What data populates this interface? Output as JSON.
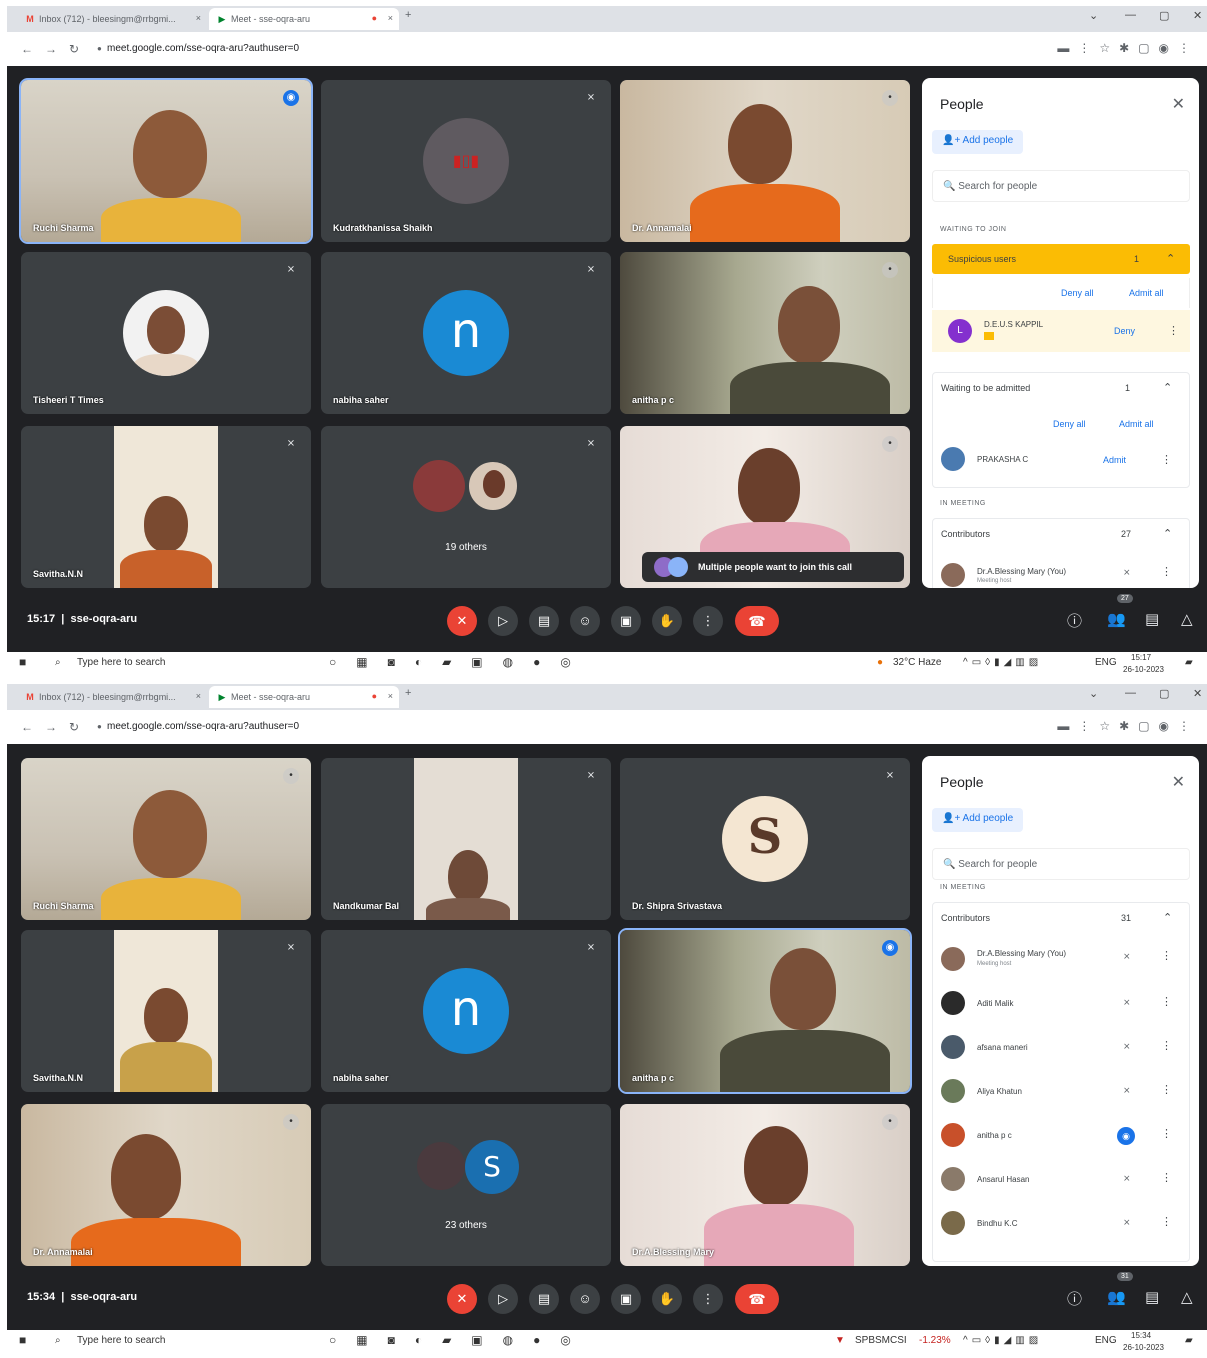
{
  "browser": {
    "tab1": "Inbox (712) - bleesingm@rrbgmi...",
    "tab2": "Meet - sse-oqra-aru",
    "url": "meet.google.com/sse-oqra-aru?authuser=0",
    "new_tab": "+"
  },
  "meeting_code": "sse-oqra-aru",
  "panel1": {
    "time": "15:17",
    "tiles": {
      "t1": "Ruchi Sharma",
      "t2": "Kudratkhanissa Shaikh",
      "t3": "Dr. Annamalai",
      "t4": "Tisheeri T Times",
      "t5": "nabiha saher",
      "t6": "anitha p c",
      "t7": "Savitha.N.N",
      "t8": "19 others",
      "t9_notice": "Multiple people want to join this call"
    },
    "avatar_letter": "n",
    "people": {
      "title": "People",
      "add": "Add people",
      "search": "Search for people",
      "waiting_section": "WAITING TO JOIN",
      "suspicious": "Suspicious users",
      "suspicious_count": "1",
      "deny_all": "Deny all",
      "admit_all": "Admit all",
      "sus_user": "D.E.U.S KAPPIL",
      "deny": "Deny",
      "waiting_admit": "Waiting to be admitted",
      "waiting_count": "1",
      "deny_all2": "Deny all",
      "admit_all2": "Admit all",
      "wait_user": "PRAKASHA C",
      "admit": "Admit",
      "in_meeting": "IN MEETING",
      "contributors": "Contributors",
      "contrib_count": "27",
      "first_user": "Dr.A.Blessing Mary (You)",
      "first_sub": "Meeting host"
    },
    "people_badge": "27",
    "taskbar": {
      "search": "Type here to search",
      "weather": "32°C Haze",
      "lang": "ENG",
      "time": "15:17",
      "date": "26-10-2023"
    }
  },
  "panel2": {
    "time": "15:34",
    "tiles": {
      "t1": "Ruchi Sharma",
      "t2": "Nandkumar Bal",
      "t3": "Dr. Shipra Srivastava",
      "t4": "Savitha.N.N",
      "t5": "nabiha saher",
      "t6": "anitha p c",
      "t7": "Dr. Annamalai",
      "t8": "23 others",
      "t9": "Dr.A.Blessing Mary"
    },
    "avatar_letter": "n",
    "bubble_letter": "S",
    "people": {
      "title": "People",
      "add": "Add people",
      "search": "Search for people",
      "in_meeting": "IN MEETING",
      "contributors": "Contributors",
      "contrib_count": "31",
      "list": [
        {
          "name": "Dr.A.Blessing Mary (You)",
          "sub": "Meeting host"
        },
        {
          "name": "Aditi Malik",
          "sub": ""
        },
        {
          "name": "afsana maneri",
          "sub": ""
        },
        {
          "name": "Aliya Khatun",
          "sub": ""
        },
        {
          "name": "anitha p c",
          "sub": ""
        },
        {
          "name": "Ansarul Hasan",
          "sub": ""
        },
        {
          "name": "Bindhu K.C",
          "sub": ""
        }
      ]
    },
    "people_badge": "31",
    "taskbar": {
      "search": "Type here to search",
      "stock": "SPBSMCSI",
      "stock_change": "-1.23%",
      "lang": "ENG",
      "time": "15:34",
      "date": "26-10-2023"
    }
  }
}
